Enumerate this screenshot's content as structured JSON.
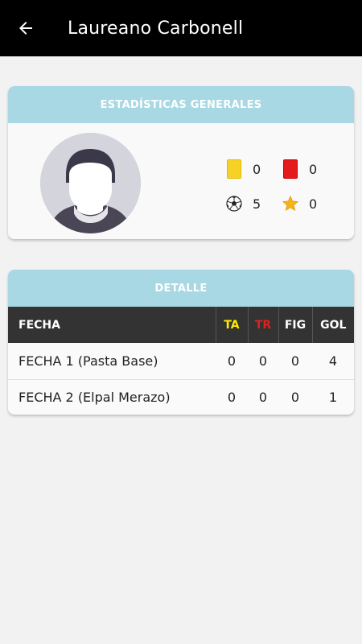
{
  "header": {
    "title": "Laureano Carbonell",
    "back_icon": "arrow-left-icon"
  },
  "general": {
    "heading": "ESTADÍSTICAS GENERALES",
    "avatar_icon": "user-avatar-icon",
    "stats": {
      "yellow_cards": "0",
      "red_cards": "0",
      "goals": "5",
      "figure": "0"
    }
  },
  "detail": {
    "heading": "DETALLE",
    "columns": {
      "fecha": "FECHA",
      "ta": "TA",
      "tr": "TR",
      "fig": "FIG",
      "gol": "GOL"
    },
    "rows": [
      {
        "fecha": "FECHA 1 (Pasta Base)",
        "ta": "0",
        "tr": "0",
        "fig": "0",
        "gol": "4"
      },
      {
        "fecha": "FECHA 2 (Elpal Merazo)",
        "ta": "0",
        "tr": "0",
        "fig": "0",
        "gol": "1"
      }
    ]
  },
  "colors": {
    "appbar": "#000000",
    "card_header": "#a8d8e3",
    "table_header": "#333333",
    "ta_label": "#ffeb00",
    "tr_label": "#e02020"
  }
}
